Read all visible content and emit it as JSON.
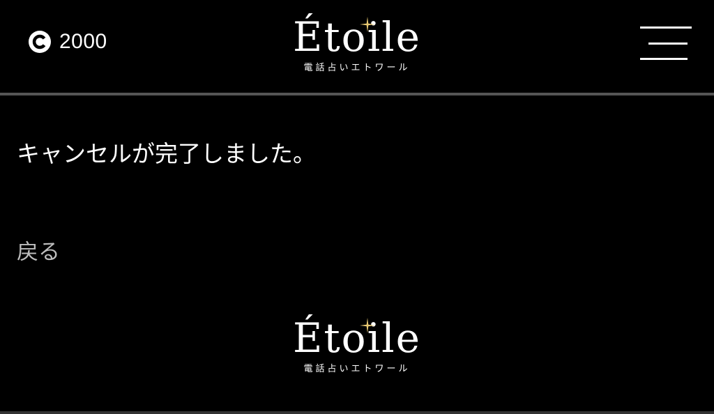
{
  "header": {
    "points": {
      "icon": "coin-c-icon",
      "value": "2000"
    },
    "logo": {
      "word": "Étoile",
      "subtitle": "電話占いエトワール"
    },
    "menu": {
      "icon": "hamburger-menu-icon"
    }
  },
  "main": {
    "message": "キャンセルが完了しました。",
    "back_label": "戻る"
  },
  "footer": {
    "logo": {
      "word": "Étoile",
      "subtitle": "電話占いエトワール"
    }
  },
  "colors": {
    "background": "#000000",
    "text": "#ffffff",
    "back_link": "#bdbdbd",
    "divider": "#555555",
    "sparkle": "#e8c872"
  }
}
